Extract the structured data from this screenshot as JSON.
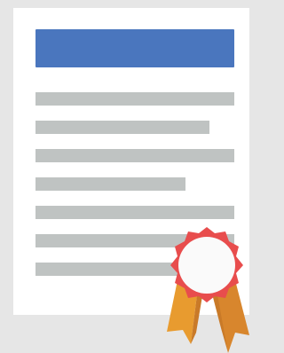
{
  "colors": {
    "page_bg": "#e6e6e6",
    "paper": "#ffffff",
    "header_bar": "#4a76be",
    "text_line": "#bfc3c2",
    "badge_outer": "#e84d4d",
    "badge_inner": "#fafafa",
    "ribbon_left": "#e89b2f",
    "ribbon_right": "#d8862d",
    "ribbon_shadow": "#c97a28"
  },
  "icon_names": {
    "document": "document-icon",
    "award": "award-badge-icon"
  },
  "text_lines": [
    {
      "fraction": 1.0
    },
    {
      "fraction": 0.875
    },
    {
      "fraction": 1.0
    },
    {
      "fraction": 0.755
    },
    {
      "fraction": 1.0
    },
    {
      "fraction": 1.0
    },
    {
      "fraction": 1.0
    }
  ]
}
